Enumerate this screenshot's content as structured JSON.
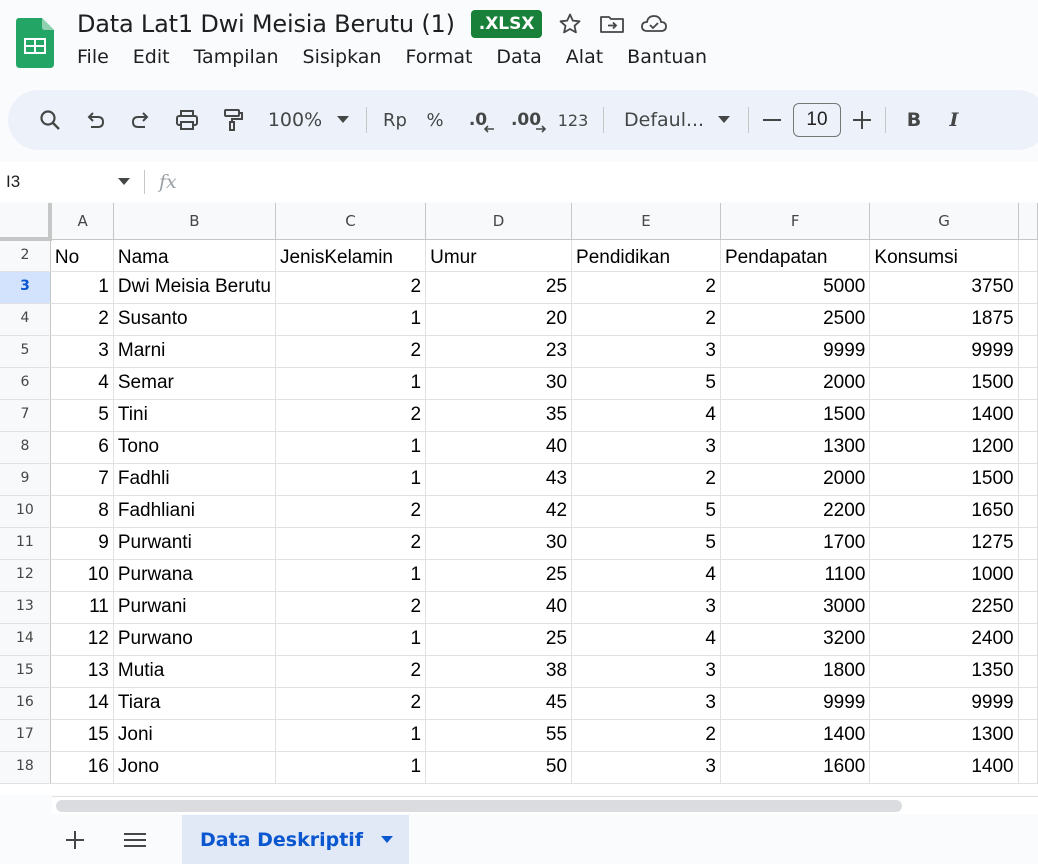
{
  "document": {
    "title": "Data Lat1 Dwi Meisia Berutu (1)",
    "badge": ".XLSX"
  },
  "menu": [
    "File",
    "Edit",
    "Tampilan",
    "Sisipkan",
    "Format",
    "Data",
    "Alat",
    "Bantuan"
  ],
  "toolbar": {
    "zoom": "100%",
    "currency": "Rp",
    "percent": "%",
    "decrease_decimal": ".0",
    "increase_decimal": ".00",
    "number_format": "123",
    "font": "Defaul...",
    "font_size": "10",
    "bold": "B",
    "italic": "I"
  },
  "formula_bar": {
    "cell_ref": "I3",
    "fx": "fx"
  },
  "columns": [
    "A",
    "B",
    "C",
    "D",
    "E",
    "F",
    "G"
  ],
  "header_row": {
    "row_number": "2",
    "cells": [
      "No",
      "Nama",
      "JenisKelamin",
      "Umur",
      "Pendidikan",
      "Pendapatan",
      "Konsumsi"
    ]
  },
  "rows": [
    {
      "row": "3",
      "cells": [
        "1",
        "Dwi Meisia Berutu",
        "2",
        "25",
        "2",
        "5000",
        "3750"
      ]
    },
    {
      "row": "4",
      "cells": [
        "2",
        "Susanto",
        "1",
        "20",
        "2",
        "2500",
        "1875"
      ]
    },
    {
      "row": "5",
      "cells": [
        "3",
        "Marni",
        "2",
        "23",
        "3",
        "9999",
        "9999"
      ]
    },
    {
      "row": "6",
      "cells": [
        "4",
        "Semar",
        "1",
        "30",
        "5",
        "2000",
        "1500"
      ]
    },
    {
      "row": "7",
      "cells": [
        "5",
        "Tini",
        "2",
        "35",
        "4",
        "1500",
        "1400"
      ]
    },
    {
      "row": "8",
      "cells": [
        "6",
        "Tono",
        "1",
        "40",
        "3",
        "1300",
        "1200"
      ]
    },
    {
      "row": "9",
      "cells": [
        "7",
        "Fadhli",
        "1",
        "43",
        "2",
        "2000",
        "1500"
      ]
    },
    {
      "row": "10",
      "cells": [
        "8",
        "Fadhliani",
        "2",
        "42",
        "5",
        "2200",
        "1650"
      ]
    },
    {
      "row": "11",
      "cells": [
        "9",
        "Purwanti",
        "2",
        "30",
        "5",
        "1700",
        "1275"
      ]
    },
    {
      "row": "12",
      "cells": [
        "10",
        "Purwana",
        "1",
        "25",
        "4",
        "1100",
        "1000"
      ]
    },
    {
      "row": "13",
      "cells": [
        "11",
        "Purwani",
        "2",
        "40",
        "3",
        "3000",
        "2250"
      ]
    },
    {
      "row": "14",
      "cells": [
        "12",
        "Purwano",
        "1",
        "25",
        "4",
        "3200",
        "2400"
      ]
    },
    {
      "row": "15",
      "cells": [
        "13",
        "Mutia",
        "2",
        "38",
        "3",
        "1800",
        "1350"
      ]
    },
    {
      "row": "16",
      "cells": [
        "14",
        "Tiara",
        "2",
        "45",
        "3",
        "9999",
        "9999"
      ]
    },
    {
      "row": "17",
      "cells": [
        "15",
        "Joni",
        "1",
        "55",
        "2",
        "1400",
        "1300"
      ]
    },
    {
      "row": "18",
      "cells": [
        "16",
        "Jono",
        "1",
        "50",
        "3",
        "1600",
        "1400"
      ]
    }
  ],
  "sheet_tab": {
    "name": "Data Deskriptif"
  },
  "colors": {
    "brand_green": "#188038",
    "selected_row": "#d3e3fd",
    "tab_text": "#0b57d0"
  }
}
